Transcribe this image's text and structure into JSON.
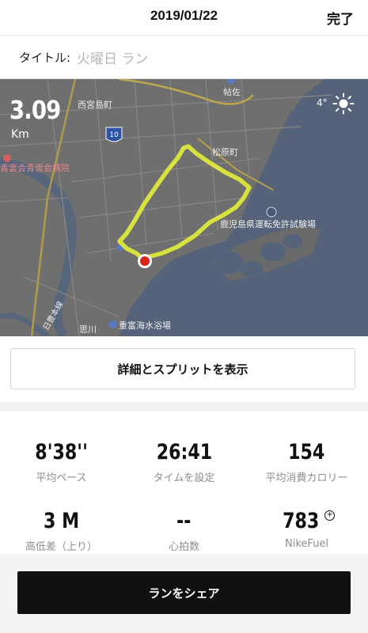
{
  "header": {
    "date": "2019/01/22",
    "done_label": "完了"
  },
  "title_row": {
    "label": "タイトル:",
    "value": "火曜日 ラン"
  },
  "map": {
    "distance": "3.09",
    "distance_unit": "Km",
    "temperature": "4°",
    "weather_icon": "sun-icon",
    "route_color": "#e0ec3a",
    "place_labels": {
      "nishimiyajima": "西宮島町",
      "aoi_hospital": "青雲会青雲会病院",
      "hosa": "帖佐",
      "matsubara": "松原町",
      "license_center": "鹿児島県運転免許試験場",
      "beach": "重富海水浴場",
      "omokawa": "思川",
      "nissho_line": "日豊本線",
      "route_10": "10"
    }
  },
  "details_button": {
    "label": "詳細とスプリットを表示"
  },
  "stats": [
    {
      "value": "8'38''",
      "label": "平均ペース"
    },
    {
      "value": "26:41",
      "label": "タイムを設定"
    },
    {
      "value": "154",
      "label": "平均消費カロリー"
    },
    {
      "value": "3 M",
      "label": "高低差（上り）"
    },
    {
      "value": "--",
      "label": "心拍数"
    },
    {
      "value": "783",
      "label": "NikeFuel"
    }
  ],
  "share_button": {
    "label": "ランをシェア"
  }
}
